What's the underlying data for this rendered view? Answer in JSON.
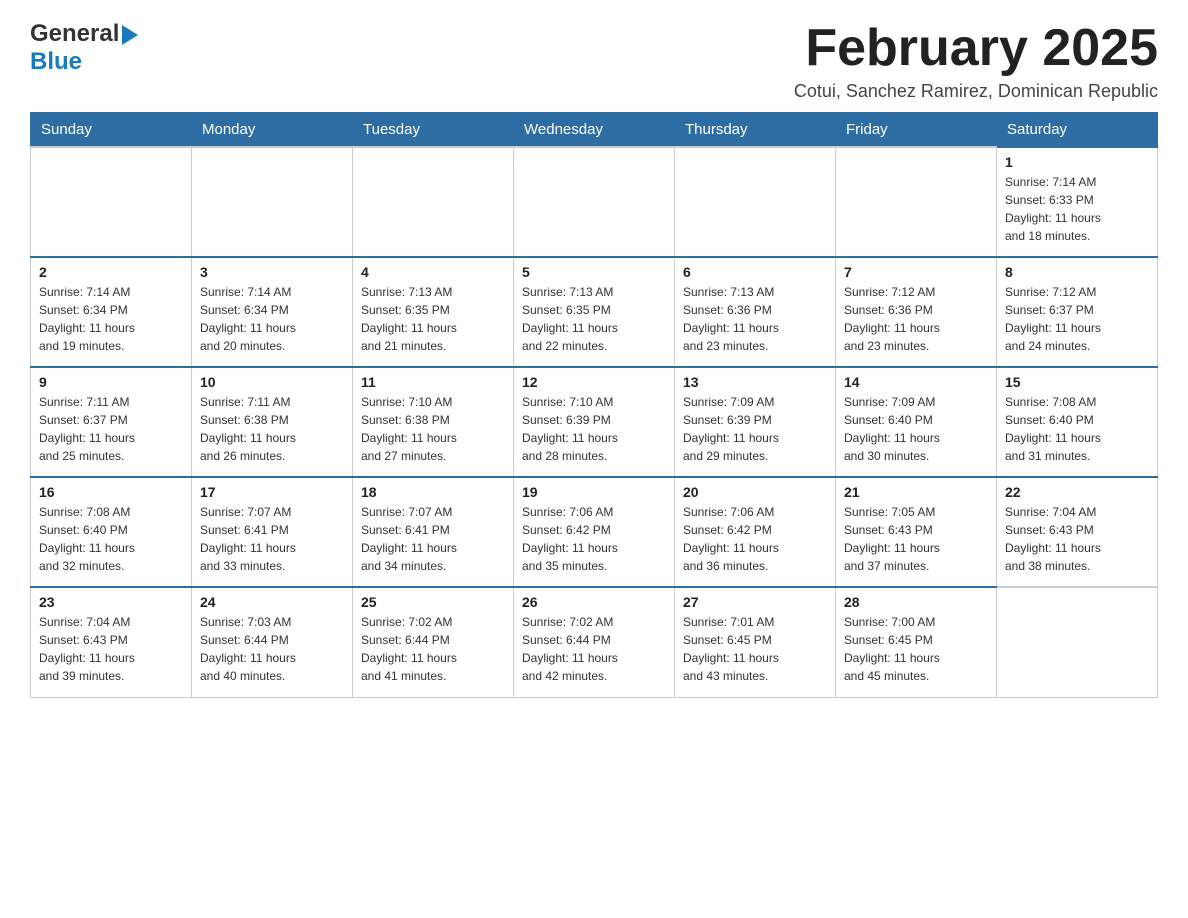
{
  "header": {
    "logo_general": "General",
    "logo_blue": "Blue",
    "title": "February 2025",
    "subtitle": "Cotui, Sanchez Ramirez, Dominican Republic"
  },
  "calendar": {
    "days_of_week": [
      "Sunday",
      "Monday",
      "Tuesday",
      "Wednesday",
      "Thursday",
      "Friday",
      "Saturday"
    ],
    "weeks": [
      [
        {
          "day": "",
          "info": ""
        },
        {
          "day": "",
          "info": ""
        },
        {
          "day": "",
          "info": ""
        },
        {
          "day": "",
          "info": ""
        },
        {
          "day": "",
          "info": ""
        },
        {
          "day": "",
          "info": ""
        },
        {
          "day": "1",
          "info": "Sunrise: 7:14 AM\nSunset: 6:33 PM\nDaylight: 11 hours\nand 18 minutes."
        }
      ],
      [
        {
          "day": "2",
          "info": "Sunrise: 7:14 AM\nSunset: 6:34 PM\nDaylight: 11 hours\nand 19 minutes."
        },
        {
          "day": "3",
          "info": "Sunrise: 7:14 AM\nSunset: 6:34 PM\nDaylight: 11 hours\nand 20 minutes."
        },
        {
          "day": "4",
          "info": "Sunrise: 7:13 AM\nSunset: 6:35 PM\nDaylight: 11 hours\nand 21 minutes."
        },
        {
          "day": "5",
          "info": "Sunrise: 7:13 AM\nSunset: 6:35 PM\nDaylight: 11 hours\nand 22 minutes."
        },
        {
          "day": "6",
          "info": "Sunrise: 7:13 AM\nSunset: 6:36 PM\nDaylight: 11 hours\nand 23 minutes."
        },
        {
          "day": "7",
          "info": "Sunrise: 7:12 AM\nSunset: 6:36 PM\nDaylight: 11 hours\nand 23 minutes."
        },
        {
          "day": "8",
          "info": "Sunrise: 7:12 AM\nSunset: 6:37 PM\nDaylight: 11 hours\nand 24 minutes."
        }
      ],
      [
        {
          "day": "9",
          "info": "Sunrise: 7:11 AM\nSunset: 6:37 PM\nDaylight: 11 hours\nand 25 minutes."
        },
        {
          "day": "10",
          "info": "Sunrise: 7:11 AM\nSunset: 6:38 PM\nDaylight: 11 hours\nand 26 minutes."
        },
        {
          "day": "11",
          "info": "Sunrise: 7:10 AM\nSunset: 6:38 PM\nDaylight: 11 hours\nand 27 minutes."
        },
        {
          "day": "12",
          "info": "Sunrise: 7:10 AM\nSunset: 6:39 PM\nDaylight: 11 hours\nand 28 minutes."
        },
        {
          "day": "13",
          "info": "Sunrise: 7:09 AM\nSunset: 6:39 PM\nDaylight: 11 hours\nand 29 minutes."
        },
        {
          "day": "14",
          "info": "Sunrise: 7:09 AM\nSunset: 6:40 PM\nDaylight: 11 hours\nand 30 minutes."
        },
        {
          "day": "15",
          "info": "Sunrise: 7:08 AM\nSunset: 6:40 PM\nDaylight: 11 hours\nand 31 minutes."
        }
      ],
      [
        {
          "day": "16",
          "info": "Sunrise: 7:08 AM\nSunset: 6:40 PM\nDaylight: 11 hours\nand 32 minutes."
        },
        {
          "day": "17",
          "info": "Sunrise: 7:07 AM\nSunset: 6:41 PM\nDaylight: 11 hours\nand 33 minutes."
        },
        {
          "day": "18",
          "info": "Sunrise: 7:07 AM\nSunset: 6:41 PM\nDaylight: 11 hours\nand 34 minutes."
        },
        {
          "day": "19",
          "info": "Sunrise: 7:06 AM\nSunset: 6:42 PM\nDaylight: 11 hours\nand 35 minutes."
        },
        {
          "day": "20",
          "info": "Sunrise: 7:06 AM\nSunset: 6:42 PM\nDaylight: 11 hours\nand 36 minutes."
        },
        {
          "day": "21",
          "info": "Sunrise: 7:05 AM\nSunset: 6:43 PM\nDaylight: 11 hours\nand 37 minutes."
        },
        {
          "day": "22",
          "info": "Sunrise: 7:04 AM\nSunset: 6:43 PM\nDaylight: 11 hours\nand 38 minutes."
        }
      ],
      [
        {
          "day": "23",
          "info": "Sunrise: 7:04 AM\nSunset: 6:43 PM\nDaylight: 11 hours\nand 39 minutes."
        },
        {
          "day": "24",
          "info": "Sunrise: 7:03 AM\nSunset: 6:44 PM\nDaylight: 11 hours\nand 40 minutes."
        },
        {
          "day": "25",
          "info": "Sunrise: 7:02 AM\nSunset: 6:44 PM\nDaylight: 11 hours\nand 41 minutes."
        },
        {
          "day": "26",
          "info": "Sunrise: 7:02 AM\nSunset: 6:44 PM\nDaylight: 11 hours\nand 42 minutes."
        },
        {
          "day": "27",
          "info": "Sunrise: 7:01 AM\nSunset: 6:45 PM\nDaylight: 11 hours\nand 43 minutes."
        },
        {
          "day": "28",
          "info": "Sunrise: 7:00 AM\nSunset: 6:45 PM\nDaylight: 11 hours\nand 45 minutes."
        },
        {
          "day": "",
          "info": ""
        }
      ]
    ]
  }
}
